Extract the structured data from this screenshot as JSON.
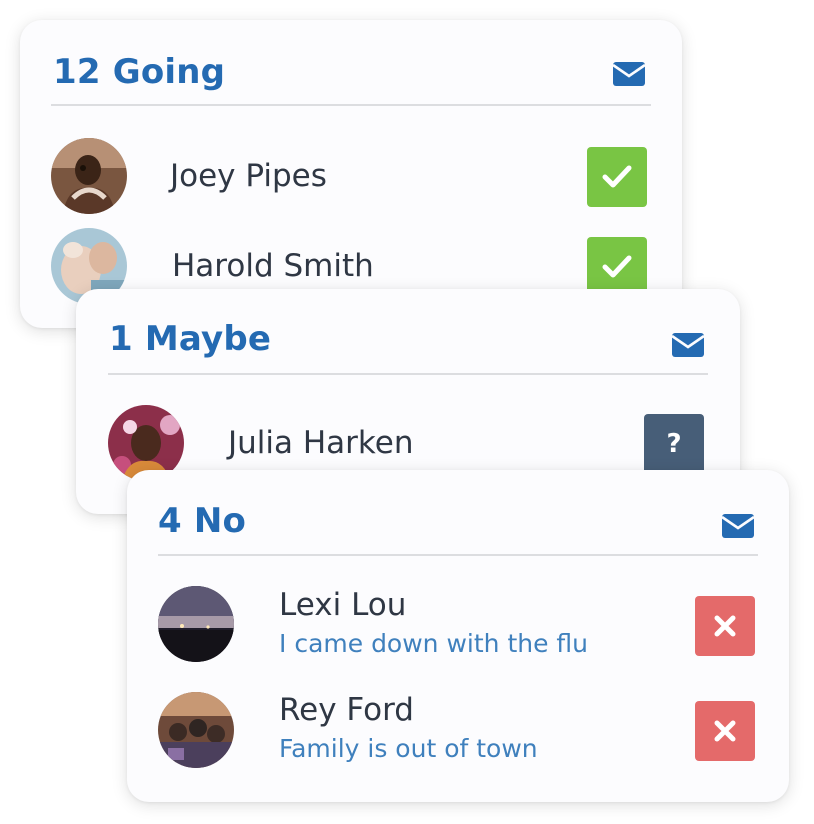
{
  "groups": [
    {
      "heading": "12 Going",
      "icon": "envelope-icon",
      "members": [
        {
          "name": "Joey Pipes",
          "status_icon": "checkmark-icon"
        },
        {
          "name": "Harold Smith",
          "status_icon": "checkmark-icon"
        }
      ]
    },
    {
      "heading": "1 Maybe",
      "icon": "envelope-icon",
      "members": [
        {
          "name": "Julia Harken",
          "status_label": "?"
        }
      ]
    },
    {
      "heading": "4 No",
      "icon": "envelope-icon",
      "members": [
        {
          "name": "Lexi Lou",
          "reason": "I came down with the flu",
          "status_icon": "x-icon"
        },
        {
          "name": "Rey Ford",
          "reason": "Family is out of town",
          "status_icon": "x-icon"
        }
      ]
    }
  ],
  "colors": {
    "heading": "#246ab2",
    "yes": "#79c544",
    "maybe": "#475e78",
    "no": "#e46a6a",
    "reason_text": "#3f80bd"
  }
}
